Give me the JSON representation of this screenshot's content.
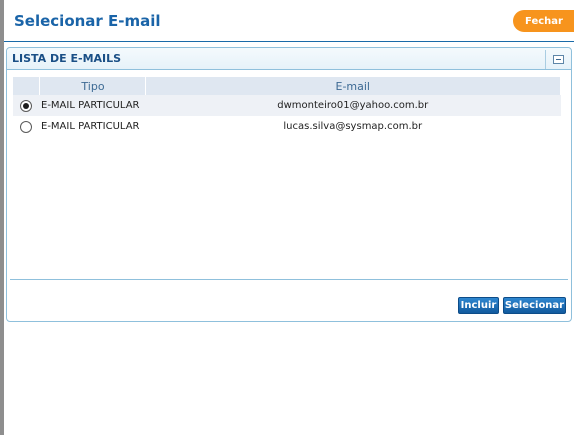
{
  "header": {
    "title": "Selecionar E-mail",
    "close_label": "Fechar"
  },
  "panel": {
    "title": "LISTA DE E-MAILS",
    "columns": [
      "Tipo",
      "E-mail"
    ],
    "rows": [
      {
        "type": "E-MAIL PARTICULAR",
        "email": "dwmonteiro01@yahoo.com.br",
        "selected": true
      },
      {
        "type": "E-MAIL PARTICULAR",
        "email": "lucas.silva@sysmap.com.br",
        "selected": false
      }
    ],
    "include_label": "Incluir",
    "select_label": "Selecionar"
  },
  "colors": {
    "title_blue": "#1a64a8",
    "close_orange": "#f7941d",
    "button_blue": "#1a6fbe"
  }
}
